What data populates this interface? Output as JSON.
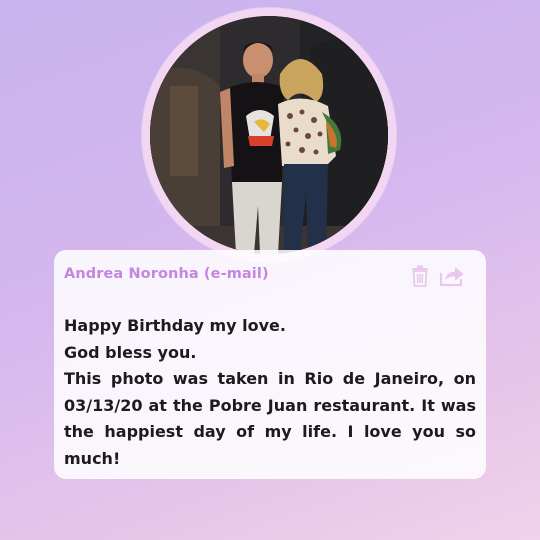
{
  "card": {
    "sender": "Andrea Noronha (e-mail)",
    "message_lines": [
      "Happy Birthday my love.",
      "God bless you.",
      "This photo was taken in Rio de Janeiro, on 03/13/20 at the Pobre Juan restaurant. It was the happiest day of my life. I love you so much!"
    ]
  },
  "icons": {
    "delete": "trash-icon",
    "share": "share-icon"
  },
  "colors": {
    "accent": "#c486e0",
    "frame": "#f3d6f2",
    "text": "#1d1b1e"
  }
}
